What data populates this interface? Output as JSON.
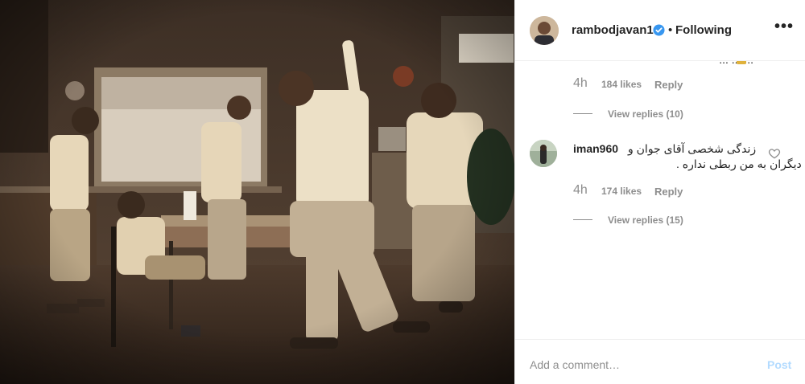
{
  "post": {
    "image_alt": "",
    "colors": {
      "wall": "#4a3a2d",
      "floor": "#3a2a20",
      "shirt": "#e9d9bd",
      "pants": "#b8a78a"
    }
  },
  "header": {
    "username": "rambodjavan1",
    "separator": "•",
    "follow_state": "Following",
    "more_icon": "more-horizontal-icon",
    "more_label": "•••"
  },
  "comments": [
    {
      "cut_text": "... ... ...",
      "time": "4h",
      "likes": "184 likes",
      "reply": "Reply",
      "view_replies": "View replies (10)"
    },
    {
      "username": "iman960",
      "text_line1": "زندگی شخصی آقای جوان و",
      "text_line2": "دیگران به من ربطی نداره .",
      "time": "4h",
      "likes": "174 likes",
      "reply": "Reply",
      "view_replies": "View replies (15)",
      "heart_icon": "heart-outline-icon"
    }
  ],
  "comment_box": {
    "placeholder": "Add a comment…",
    "post_label": "Post"
  }
}
